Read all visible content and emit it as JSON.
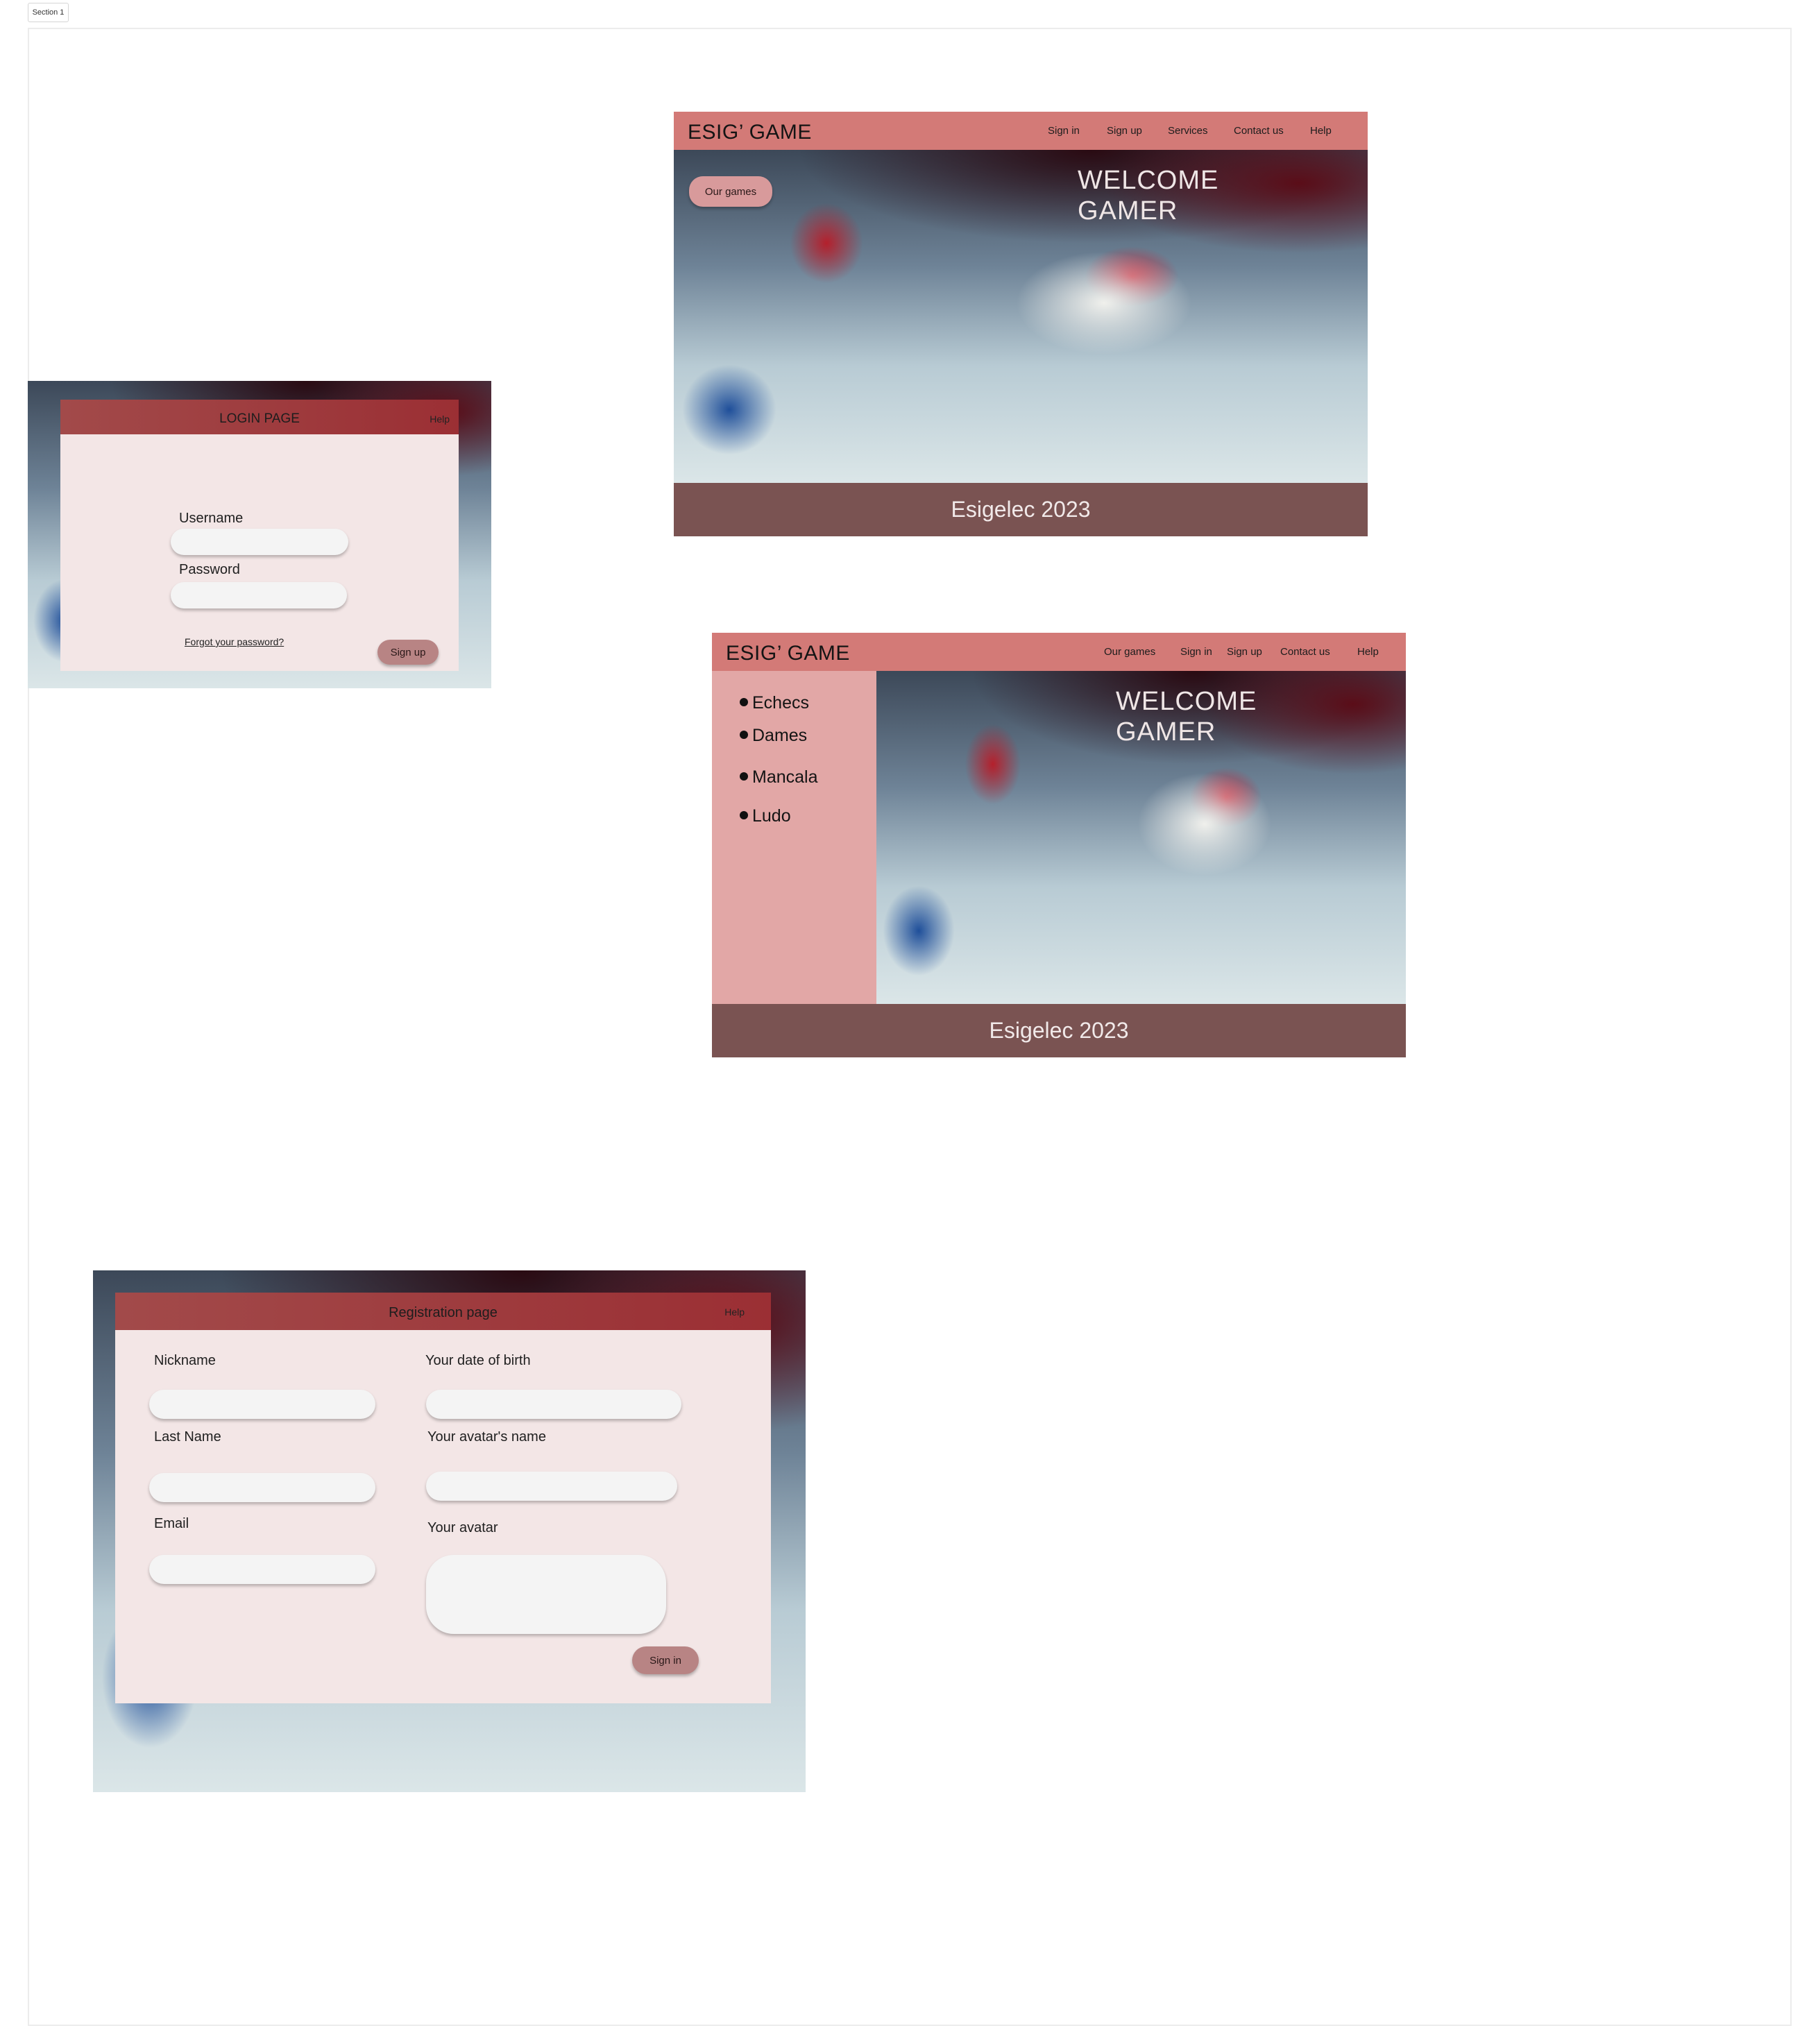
{
  "canvas": {
    "section_label": "Section 1"
  },
  "login": {
    "title": "LOGIN PAGE",
    "help": "Help",
    "username_label": "Username",
    "username_value": "",
    "password_label": "Password",
    "password_value": "",
    "forgot_link": "Forgot your password?",
    "signup_button": "Sign up"
  },
  "home1": {
    "brand": "ESIG’ GAME",
    "nav": [
      "Sign in",
      "Sign up",
      "Services",
      "Contact us",
      "Help"
    ],
    "our_games_button": "Our games",
    "welcome_line1": "WELCOME",
    "welcome_line2": "GAMER",
    "footer": "Esigelec 2023"
  },
  "home2": {
    "brand": "ESIG’ GAME",
    "nav": [
      "Our games",
      "Sign in",
      "Sign up",
      "Contact us",
      "Help"
    ],
    "games": [
      "Echecs",
      "Dames",
      "Mancala",
      "Ludo"
    ],
    "welcome_line1": "WELCOME",
    "welcome_line2": "GAMER",
    "footer": "Esigelec 2023"
  },
  "registration": {
    "title": "Registration page",
    "help": "Help",
    "nickname_label": "Nickname",
    "lastname_label": "Last Name",
    "email_label": "Email",
    "dob_label": "Your date of birth",
    "avatar_name_label": "Your avatar's name",
    "avatar_label": "Your avatar",
    "signin_button": "Sign in"
  },
  "colors": {
    "nav_bar": "#d37a77",
    "footer_bar": "#7a5352",
    "sidebar": "#e2a7a6",
    "card_bg": "#f3e6e6",
    "card_header": "#9b2f34",
    "button": "#b88484"
  }
}
